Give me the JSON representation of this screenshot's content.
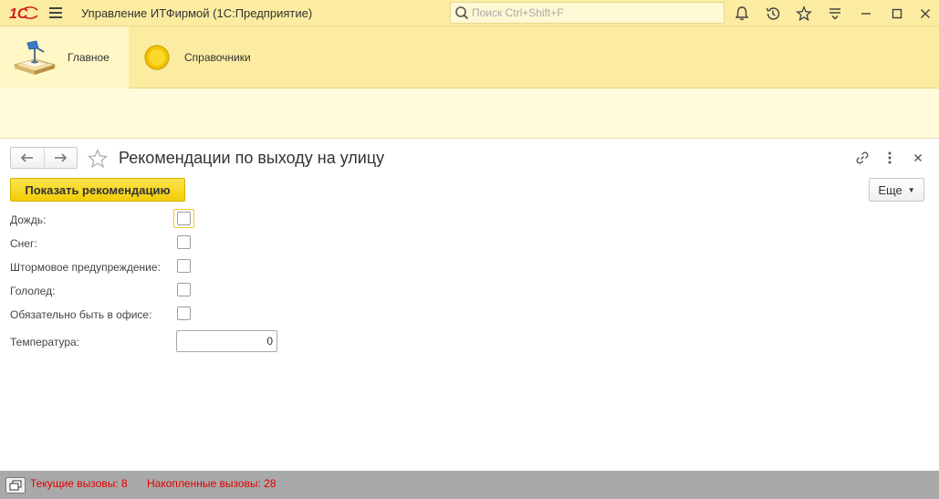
{
  "titlebar": {
    "logo_text": "1С",
    "app_title": "Управление ИТФирмой  (1С:Предприятие)",
    "search_placeholder": "Поиск Ctrl+Shift+F",
    "icons": [
      "bell-icon",
      "history-icon",
      "star-icon",
      "settings-icon",
      "minimize-icon",
      "maximize-icon",
      "close-icon"
    ]
  },
  "sections": [
    {
      "label": "Главное",
      "icon": "desk-lamp-icon",
      "active": true
    },
    {
      "label": "Справочники",
      "icon": "yellow-circle-icon",
      "active": false
    }
  ],
  "form": {
    "title": "Рекомендации по выходу на улицу",
    "show_button": "Показать рекомендацию",
    "more_button": "Еще",
    "fields": [
      {
        "label": "Дождь:",
        "type": "checkbox",
        "checked": false,
        "focused": true
      },
      {
        "label": "Снег:",
        "type": "checkbox",
        "checked": false
      },
      {
        "label": "Штормовое предупреждение:",
        "type": "checkbox",
        "checked": false
      },
      {
        "label": "Гололед:",
        "type": "checkbox",
        "checked": false
      },
      {
        "label": "Обязательно быть в офисе:",
        "type": "checkbox",
        "checked": false
      }
    ],
    "temperature_label": "Температура:",
    "temperature_value": "0"
  },
  "statusbar": {
    "current_calls": "Текущие вызовы: 8",
    "accumulated_calls": "Накопленные вызовы: 28",
    "text_color": "#e20000"
  },
  "colors": {
    "accent_yellow": "#fbeca1",
    "button_yellow": "#f3cd08",
    "status_bg": "#a9a9a9"
  }
}
